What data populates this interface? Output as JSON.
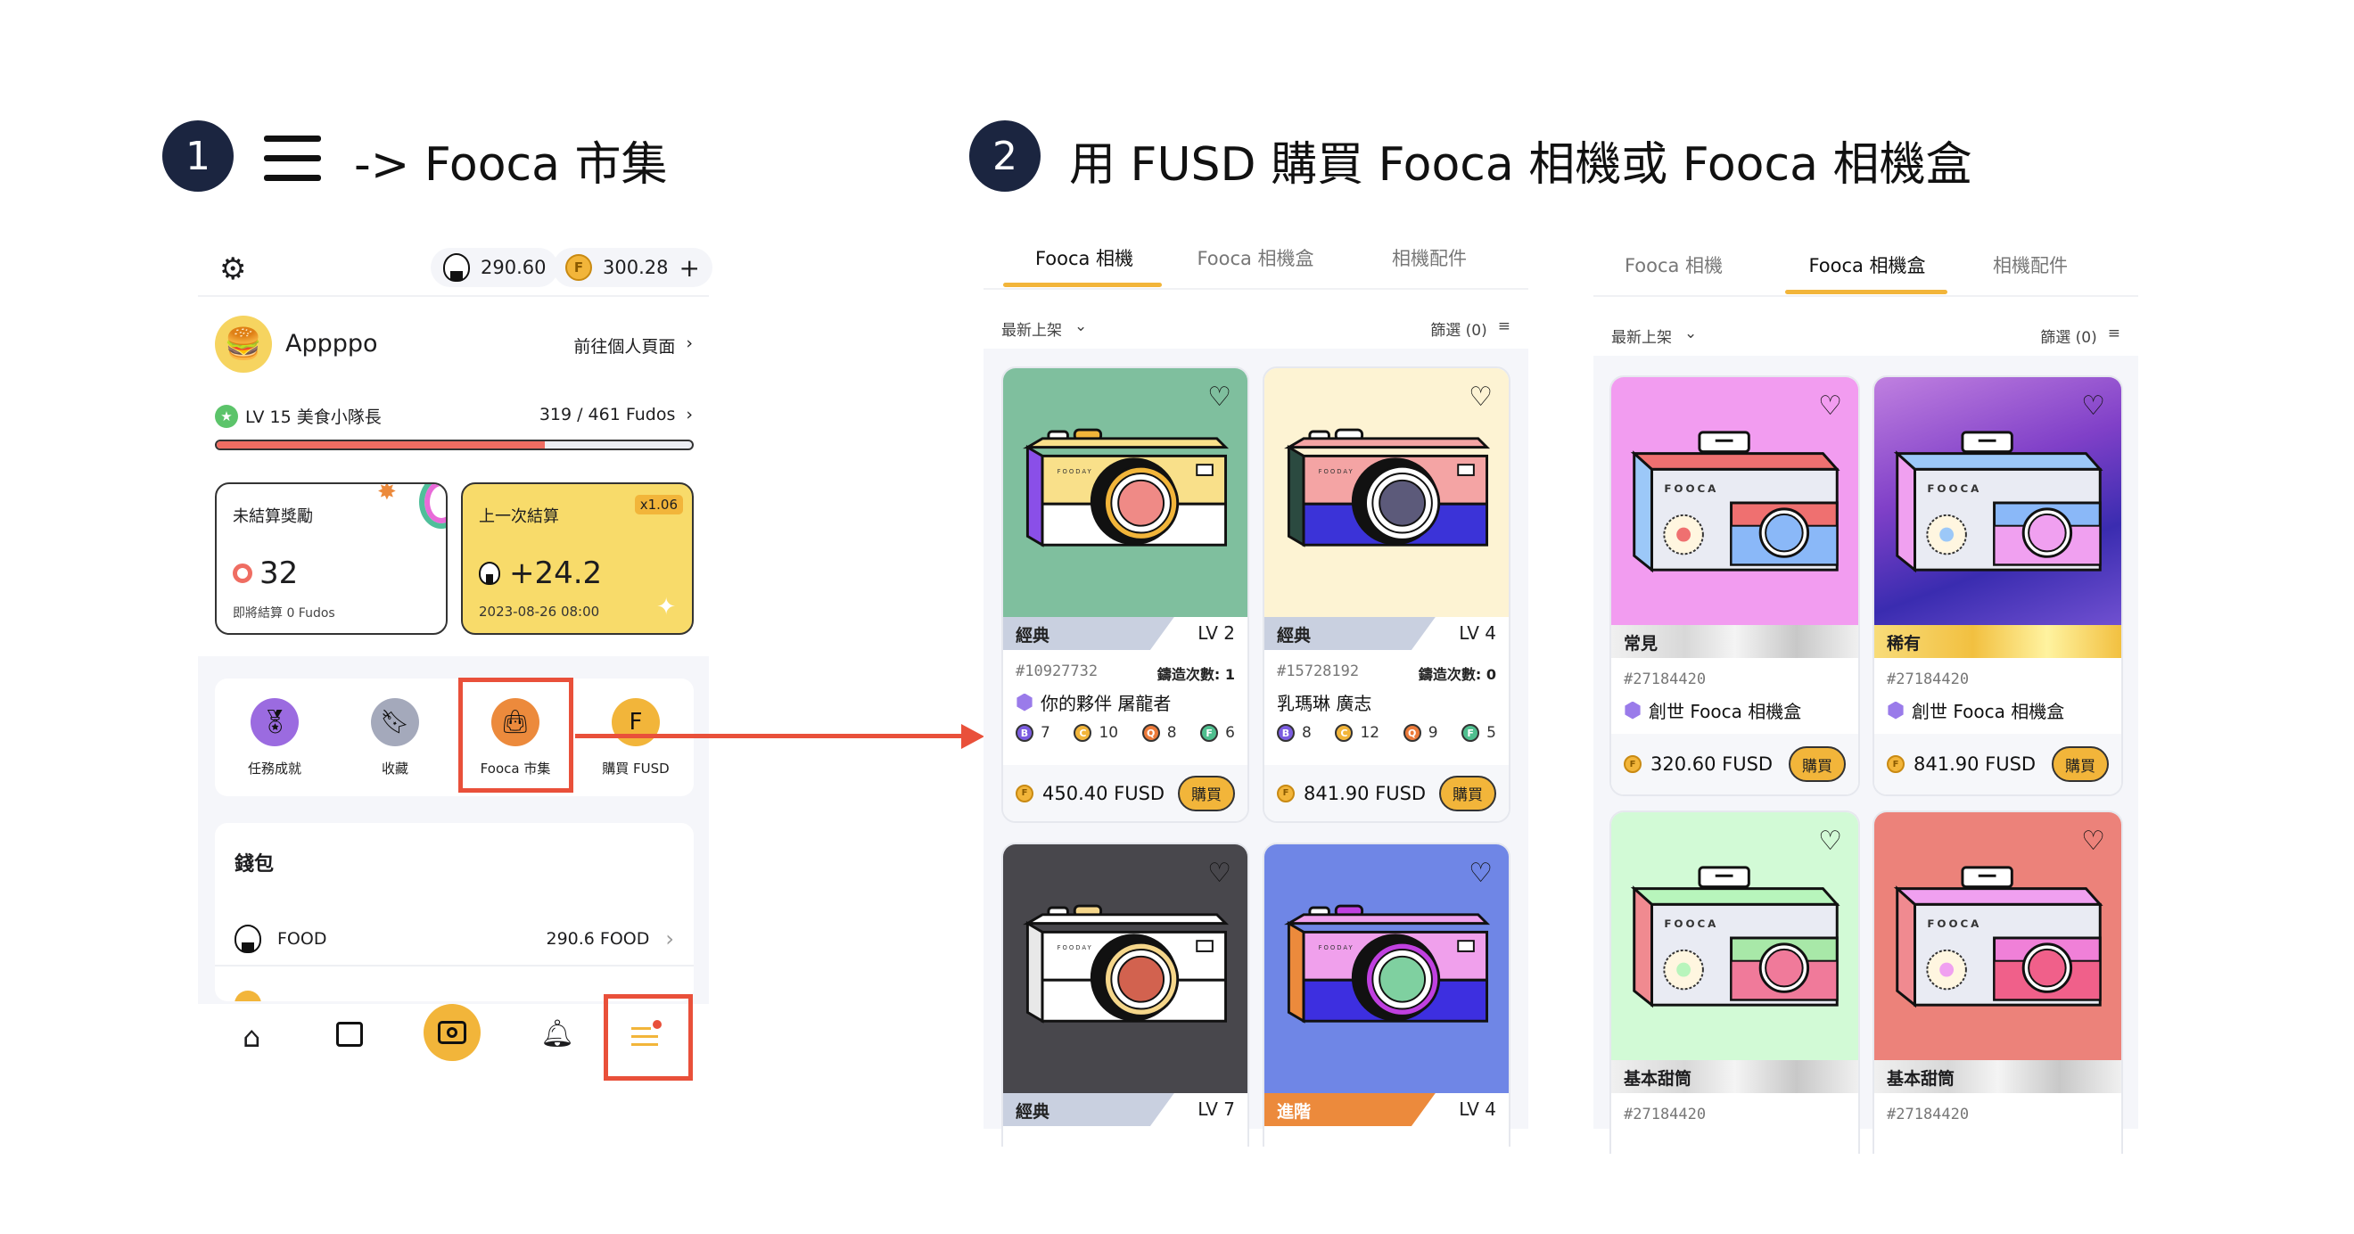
{
  "steps": [
    {
      "number": "1",
      "title": "-> Fooca 市集"
    },
    {
      "number": "2",
      "title": "用 FUSD 購買 Fooca 相機或 Fooca 相機盒"
    }
  ],
  "app": {
    "food_balance": "290.60",
    "fusd_balance": "300.28",
    "add": "+",
    "username": "Appppo",
    "profile_link": "前往個人頁面",
    "level": "LV 15 美食小隊長",
    "fudos": "319 / 461 Fudos",
    "progress": 0.69,
    "unsettled": {
      "title": "未結算獎勵",
      "value": "32",
      "sub": "即將結算 0 Fudos"
    },
    "last": {
      "title": "上一次結算",
      "multiplier": "x1.06",
      "value": "+24.2",
      "date": "2023-08-26 08:00"
    },
    "menu": [
      {
        "label": "任務成就",
        "icon": "medal-icon",
        "color": "#9b6be0"
      },
      {
        "label": "收藏",
        "icon": "bookmark-icon",
        "color": "#a4a9bb"
      },
      {
        "label": "Fooca 市集",
        "icon": "shopping-bag-icon",
        "color": "#ec8a3c"
      },
      {
        "label": "購買 FUSD",
        "icon": "fusd-coin-icon",
        "color": "#f2b53a"
      }
    ],
    "wallet": {
      "title": "錢包",
      "rows": [
        {
          "name": "FOOD",
          "amount": "290.6 FOOD"
        }
      ]
    }
  },
  "market_cameras": {
    "tabs": [
      "Fooca 相機",
      "Fooca 相機盒",
      "相機配件"
    ],
    "active": 0,
    "sort": "最新上架",
    "filter": "篩選 (0)",
    "buy": "購買",
    "cards": [
      {
        "rarity": "經典",
        "lv": "LV 2",
        "id": "#10927732",
        "mint": "鑄造次數: 1",
        "name": "你的夥伴 屠龍者",
        "badge": true,
        "stats": [
          [
            "B",
            "7"
          ],
          [
            "C",
            "10"
          ],
          [
            "Q",
            "8"
          ],
          [
            "F",
            "6"
          ]
        ],
        "price": "450.40 FUSD",
        "bg": "#7fbf9e",
        "band": "#c9d0e0",
        "top": "#f9e08a",
        "bottom": "#ffffff",
        "lens": "#ef8a86",
        "side": "#8a4fe8",
        "ring": "#f2b53a"
      },
      {
        "rarity": "經典",
        "lv": "LV 4",
        "id": "#15728192",
        "mint": "鑄造次數: 0",
        "name": "乳瑪琳 廣志",
        "badge": false,
        "stats": [
          [
            "B",
            "8"
          ],
          [
            "C",
            "12"
          ],
          [
            "Q",
            "9"
          ],
          [
            "F",
            "5"
          ]
        ],
        "price": "841.90 FUSD",
        "bg": "#fdf3d3",
        "band": "#c9d0e0",
        "top": "#f4a4a4",
        "bottom": "#3b33d8",
        "lens": "#5c5a7a",
        "side": "#2b4a40",
        "ring": "#ffffff"
      },
      {
        "rarity": "經典",
        "lv": "LV 7",
        "bg": "#48474c",
        "band": "#c9d0e0",
        "top": "#ffffff",
        "bottom": "#ffffff",
        "lens": "#d2624f",
        "side": "#e8e8e8",
        "ring": "#f5d68a"
      },
      {
        "rarity": "進階",
        "lv": "LV 4",
        "bg": "#6f86e6",
        "band": "#ec8a3c",
        "top": "#f0a0ec",
        "bottom": "#3d2fe0",
        "lens": "#7fd0a0",
        "side": "#ec8a3c",
        "ring": "#c040e0"
      }
    ]
  },
  "market_boxes": {
    "tabs": [
      "Fooca 相機",
      "Fooca 相機盒",
      "相機配件"
    ],
    "active": 1,
    "sort": "最新上架",
    "filter": "篩選 (0)",
    "buy": "購買",
    "cards": [
      {
        "rarity": "常見",
        "id": "#27184420",
        "name": "創世 Fooca 相機盒",
        "price": "320.60 FUSD",
        "bg": "#f29cf0",
        "band": "silver",
        "lid": "#ef7070",
        "side": "#9cc8f8",
        "cam": "#ef7070",
        "cam2": "#8ab8f8"
      },
      {
        "rarity": "稀有",
        "id": "#27184420",
        "name": "創世 Fooca 相機盒",
        "price": "841.90 FUSD",
        "bg": "#6a3fd0",
        "band": "gold",
        "lid": "#9cc8f8",
        "side": "#f0a0f0",
        "cam": "#8ab8f8",
        "cam2": "#f0a0f0"
      },
      {
        "rarity": "基本甜筒",
        "id": "#27184420",
        "bg": "#d2fad6",
        "band": "silver",
        "lid": "#b8f5bc",
        "side": "#f08a90",
        "cam": "#a8e8a8",
        "cam2": "#f07a9a"
      },
      {
        "rarity": "基本甜筒",
        "id": "#27184420",
        "bg": "#ec827a",
        "band": "silver",
        "lid": "#f0a0f0",
        "side": "#f08a90",
        "cam": "#f080d8",
        "cam2": "#f0608a"
      }
    ]
  },
  "colors": {
    "accent": "#f2b53a",
    "highlight": "#e9503a",
    "navy": "#1b2540"
  }
}
